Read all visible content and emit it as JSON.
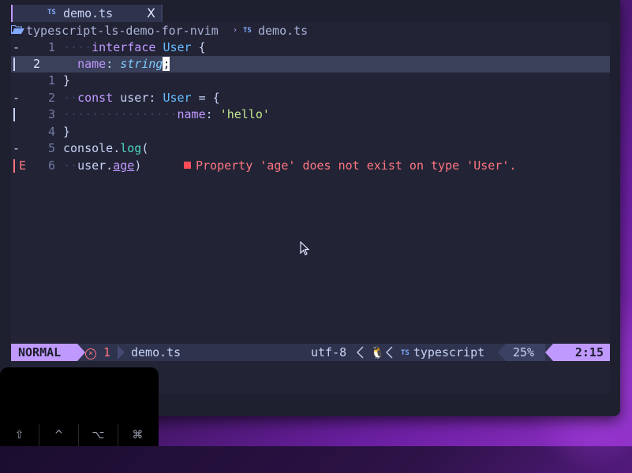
{
  "tabline": {
    "tab": {
      "icon": "TS",
      "name": "demo.ts",
      "close": "X"
    }
  },
  "winbar": {
    "folder_icon": "folder-open-icon",
    "path": "typescript-ls-demo-for-nvim",
    "separator": "›",
    "file_icon": "TS",
    "file": "demo.ts"
  },
  "editor": {
    "lines": [
      {
        "sign": "-",
        "num": "1",
        "indent": "····",
        "parts": [
          "interface",
          " ",
          "User",
          " ",
          "{"
        ]
      },
      {
        "sign": "",
        "num": "2",
        "indent": "··",
        "parts": [
          "name",
          ": ",
          "string",
          ";"
        ]
      },
      {
        "sign": "",
        "num": "1",
        "indent": "",
        "parts": [
          "}"
        ]
      },
      {
        "sign": "-",
        "num": "2",
        "indent": "··",
        "parts": [
          "const",
          " user: ",
          "User",
          " = {"
        ]
      },
      {
        "sign": "",
        "num": "3",
        "indent": "················",
        "parts": [
          "name",
          ": ",
          "'hello'"
        ]
      },
      {
        "sign": "",
        "num": "4",
        "indent": "",
        "parts": [
          "}"
        ]
      },
      {
        "sign": "-",
        "num": "5",
        "indent": "",
        "parts": [
          "console.",
          "log",
          "("
        ]
      },
      {
        "sign": "E",
        "num": "6",
        "indent": "··",
        "parts": [
          "user.",
          "age",
          ")"
        ]
      }
    ],
    "diagnostic": "Property 'age' does not exist on type 'User'."
  },
  "statusline": {
    "mode": "NORMAL",
    "error_count": "1",
    "error_icon": "x-circle-icon",
    "file": "demo.ts",
    "encoding": "utf-8",
    "os_icon": "penguin-icon",
    "filetype_icon": "TS",
    "filetype": "typescript",
    "percent": "25%",
    "position": "2:15"
  },
  "keyboard": {
    "keys": [
      "⇧",
      "^",
      "⌥",
      "⌘"
    ]
  },
  "colors": {
    "accent": "#c099ff",
    "error": "#ff757f",
    "background": "#222436"
  }
}
